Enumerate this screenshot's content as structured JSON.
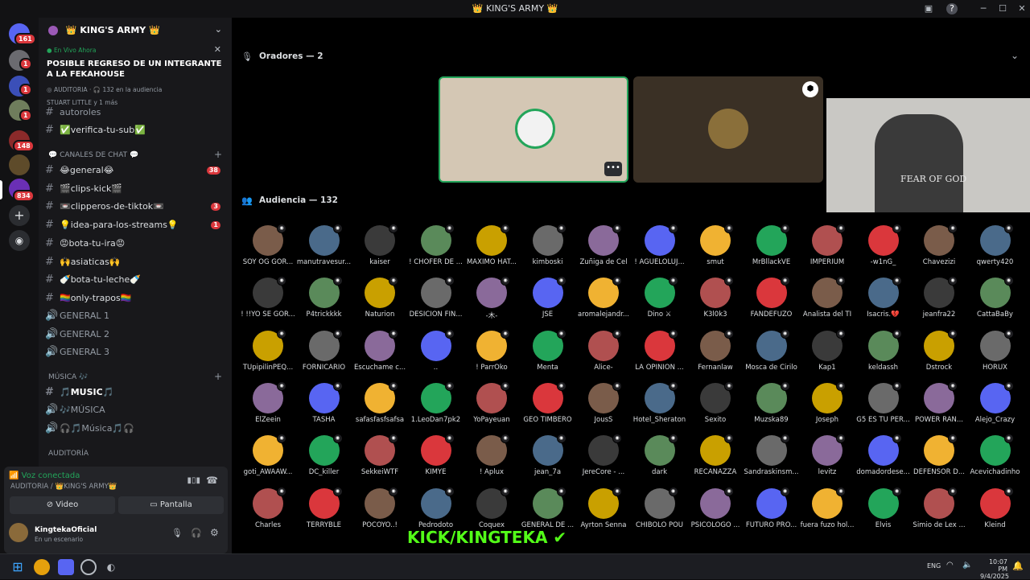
{
  "window": {
    "title": "👑 KING'S ARMY 👑"
  },
  "rail": {
    "badges": [
      "161",
      "1",
      "1",
      "1",
      "148",
      "834"
    ]
  },
  "guild": {
    "name": "👑 KING'S ARMY 👑"
  },
  "live_event": {
    "tag": "En Vivo Ahora",
    "title": "POSIBLE REGRESO DE UN INTEGRANTE A LA FEKAHOUSE",
    "channel": "AUDITORIA",
    "audience": "132 en la audiencia",
    "host": "STUART LITTLE y 1 más"
  },
  "channels": [
    {
      "name": "autoroles",
      "count": ""
    },
    {
      "name": "✅verifica-tu-sub✅",
      "count": ""
    }
  ],
  "categories": {
    "chat": "💬 CANALES DE CHAT 💬",
    "music": "MÚSICA 🎶",
    "audit": "AUDITORÍA"
  },
  "chat_channels": [
    {
      "name": "😂general😂",
      "count": "38"
    },
    {
      "name": "🎬clips-kick🎬",
      "count": ""
    },
    {
      "name": "📼clipperos-de-tiktok📼",
      "count": "3"
    },
    {
      "name": "💡idea-para-los-streams💡",
      "count": "1"
    },
    {
      "name": "😡bota-tu-ira😡",
      "count": ""
    },
    {
      "name": "🙌asiaticas🙌",
      "count": ""
    },
    {
      "name": "🍼bota-tu-leche🍼",
      "count": ""
    },
    {
      "name": "🏳️‍🌈only-trapos🏳️‍🌈",
      "count": ""
    }
  ],
  "voice_channels": [
    "GENERAL 1",
    "GENERAL 2",
    "GENERAL 3"
  ],
  "music_channels": [
    "🎵MUSIC🎵",
    "🎶MÚSICA",
    "🎧🎵Música🎵🎧"
  ],
  "voice_panel": {
    "status": "Voz conectada",
    "location": "AUDITORIA / 👑KING'S ARMY👑",
    "video_label": "Video",
    "screen_label": "Pantalla"
  },
  "user": {
    "name": "KingtekaOficial",
    "status": "En un escenario"
  },
  "stage": {
    "speakers_label": "Oradores — 2",
    "audience_label": "Audiencia — 132"
  },
  "audience": [
    "SOY OG GOR...",
    "manutravesur...",
    "kaiser",
    "! CHOFER DE ...",
    "MAXIMO HAT...",
    "kimboski",
    "Zuñiga de Cel",
    "! AGUELOLUJ...",
    "smut",
    "MrBllackVE",
    "IMPERIUM",
    "-w1nG_",
    "Chavezizi",
    "qwerty420",
    "! !!YO SE GOR...",
    "P4trickkkk",
    "Naturion",
    "DESICION FIN...",
    "-木-",
    "JSE",
    "aromalejandr...",
    "Dino ⚔",
    "K3l0k3",
    "FANDEFUZO",
    "Analista del TI",
    "Isacris.💔",
    "jeanfra22",
    "CattaBaBy",
    "TUpipilinPEQ...",
    "FORNICARIO",
    "Escuchame c...",
    "..",
    "! ParrOko",
    "Menta",
    "Alice-",
    "LA OPINION ...",
    "Fernanlaw",
    "Mosca de Cirilo",
    "Kap1",
    "keldassh",
    "Dstrock",
    "HORUX",
    "ElZeein",
    "TASHA",
    "safasfasfsafsa",
    "1.LeoDan7pk2",
    "YoPayeuan",
    "GEO TIMBERO",
    "JousS",
    "Hotel_Sheraton",
    "Sexito",
    "Muzska89",
    "Joseph",
    "G5 ES TU PER...",
    "POWER RAN...",
    "Alejo_Crazy",
    "goti_AWAAW...",
    "DC_killer",
    "SekkeiWTF",
    "KIMYE",
    "! Aplux",
    "jean_7a",
    "JereCore - ...",
    "dark",
    "RECANAZZA",
    "Sandraskinsm...",
    "levitz",
    "domadordese...",
    "DEFENSOR D...",
    "Acevichadinho",
    "Charles",
    "TERRYBLE",
    "POCOYO..!",
    "Pedrodoto",
    "Coquex",
    "GENERAL DE ...",
    "Ayrton Senna",
    "CHIBOLO POU",
    "PSICOLOGO ...",
    "FUTURO PRO...",
    "fuera fuzo hol...",
    "Elvis",
    "Simio de Lex ...",
    "Kleind"
  ],
  "overlay": {
    "text": "KICK/KINGTEKA"
  },
  "webcam": {
    "shirt_text": "FEAR OF GOD"
  },
  "taskbar": {
    "lang": "ENG",
    "time": "10:07 PM",
    "date": "9/4/2025"
  }
}
